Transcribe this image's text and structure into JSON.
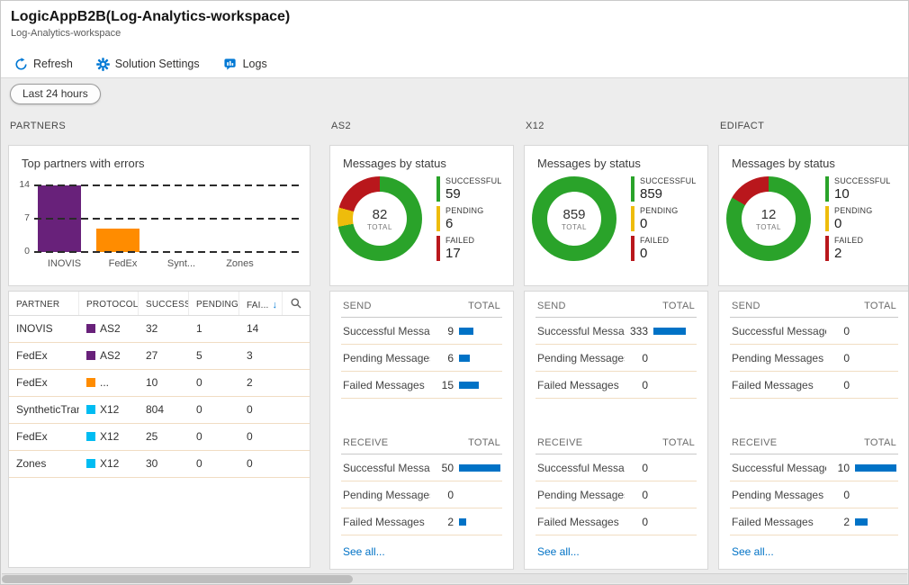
{
  "header": {
    "title": "LogicAppB2B(Log-Analytics-workspace)",
    "subtitle": "Log-Analytics-workspace"
  },
  "toolbar": {
    "refresh": "Refresh",
    "solution_settings": "Solution Settings",
    "logs": "Logs"
  },
  "filter": {
    "time_range": "Last 24 hours"
  },
  "icons": {
    "sort_descending": "↓"
  },
  "colors": {
    "successful": "#2aa32a",
    "pending": "#eebc0c",
    "failed": "#b9171c",
    "purple": "#68217a",
    "orange": "#ff8c00",
    "cyan": "#00bcf2",
    "bar_blue": "#0072c6",
    "accent_blue": "#0078d4",
    "link_blue": "#0072c6"
  },
  "partners": {
    "label": "PARTNERS",
    "chart_title": "Top partners with errors",
    "chart_data": {
      "type": "bar",
      "title": "Top partners with errors",
      "categories": [
        "INOVIS",
        "FedEx",
        "Synt...",
        "Zones"
      ],
      "values": [
        14,
        5,
        0,
        0
      ],
      "bar_colors": [
        "purple",
        "orange",
        "",
        ""
      ],
      "yticks": [
        14,
        7,
        0
      ],
      "ylim": [
        0,
        14
      ],
      "grid": "dashed-horizontal"
    },
    "table": {
      "headers": [
        "PARTNER",
        "PROTOCOL",
        "SUCCESS",
        "PENDING",
        "FAI..."
      ],
      "sort_column_index": 4,
      "rows": [
        {
          "partner": "INOVIS",
          "protocol": "AS2",
          "protocol_color": "purple",
          "success": "32",
          "pending": "1",
          "failed": "14"
        },
        {
          "partner": "FedEx",
          "protocol": "AS2",
          "protocol_color": "purple",
          "success": "27",
          "pending": "5",
          "failed": "3"
        },
        {
          "partner": "FedEx",
          "protocol": "...",
          "protocol_color": "orange",
          "success": "10",
          "pending": "0",
          "failed": "2"
        },
        {
          "partner": "SyntheticTrans",
          "protocol": "X12",
          "protocol_color": "cyan",
          "success": "804",
          "pending": "0",
          "failed": "0"
        },
        {
          "partner": "FedEx",
          "protocol": "X12",
          "protocol_color": "cyan",
          "success": "25",
          "pending": "0",
          "failed": "0"
        },
        {
          "partner": "Zones",
          "protocol": "X12",
          "protocol_color": "cyan",
          "success": "30",
          "pending": "0",
          "failed": "0"
        }
      ]
    }
  },
  "columns": [
    {
      "label": "AS2",
      "card_title": "Messages by status",
      "donut": {
        "total": "82",
        "total_label": "TOTAL",
        "legend": [
          {
            "label": "SUCCESSFUL",
            "value": 59,
            "color": "successful"
          },
          {
            "label": "PENDING",
            "value": 6,
            "color": "pending"
          },
          {
            "label": "FAILED",
            "value": 17,
            "color": "failed"
          }
        ]
      },
      "send": {
        "header": "SEND",
        "total_header": "TOTAL",
        "rows": [
          {
            "label": "Successful Messages",
            "value": 9,
            "bar": 16
          },
          {
            "label": "Pending Messages",
            "value": 6,
            "bar": 12
          },
          {
            "label": "Failed Messages",
            "value": 15,
            "bar": 22
          }
        ]
      },
      "receive": {
        "header": "RECEIVE",
        "total_header": "TOTAL",
        "rows": [
          {
            "label": "Successful Messages",
            "value": 50,
            "bar": 46
          },
          {
            "label": "Pending Messages",
            "value": 0,
            "bar": 0
          },
          {
            "label": "Failed Messages",
            "value": 2,
            "bar": 8
          }
        ]
      },
      "see_all": "See all..."
    },
    {
      "label": "X12",
      "card_title": "Messages by status",
      "donut": {
        "total": "859",
        "total_label": "TOTAL",
        "legend": [
          {
            "label": "SUCCESSFUL",
            "value": 859,
            "color": "successful"
          },
          {
            "label": "PENDING",
            "value": 0,
            "color": "pending"
          },
          {
            "label": "FAILED",
            "value": 0,
            "color": "failed"
          }
        ]
      },
      "send": {
        "header": "SEND",
        "total_header": "TOTAL",
        "rows": [
          {
            "label": "Successful Messages",
            "value": 333,
            "bar": 36
          },
          {
            "label": "Pending Messages",
            "value": 0,
            "bar": 0
          },
          {
            "label": "Failed Messages",
            "value": 0,
            "bar": 0
          }
        ]
      },
      "receive": {
        "header": "RECEIVE",
        "total_header": "TOTAL",
        "rows": [
          {
            "label": "Successful Messages",
            "value": 0,
            "bar": 0
          },
          {
            "label": "Pending Messages",
            "value": 0,
            "bar": 0
          },
          {
            "label": "Failed Messages",
            "value": 0,
            "bar": 0
          }
        ]
      },
      "see_all": "See all..."
    },
    {
      "label": "EDIFACT",
      "card_title": "Messages by status",
      "donut": {
        "total": "12",
        "total_label": "TOTAL",
        "legend": [
          {
            "label": "SUCCESSFUL",
            "value": 10,
            "color": "successful"
          },
          {
            "label": "PENDING",
            "value": 0,
            "color": "pending"
          },
          {
            "label": "FAILED",
            "value": 2,
            "color": "failed"
          }
        ]
      },
      "send": {
        "header": "SEND",
        "total_header": "TOTAL",
        "rows": [
          {
            "label": "Successful Messages",
            "value": 0,
            "bar": 0
          },
          {
            "label": "Pending Messages",
            "value": 0,
            "bar": 0
          },
          {
            "label": "Failed Messages",
            "value": 0,
            "bar": 0
          }
        ]
      },
      "receive": {
        "header": "RECEIVE",
        "total_header": "TOTAL",
        "rows": [
          {
            "label": "Successful Messages",
            "value": 10,
            "bar": 46
          },
          {
            "label": "Pending Messages",
            "value": 0,
            "bar": 0
          },
          {
            "label": "Failed Messages",
            "value": 2,
            "bar": 14
          }
        ]
      },
      "see_all": "See all..."
    }
  ]
}
